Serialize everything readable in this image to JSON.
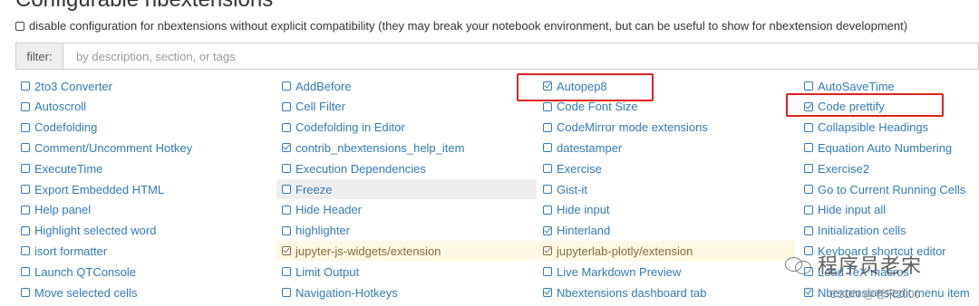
{
  "page": {
    "title": "Configurable nbextensions",
    "compat_checkbox_label": "disable configuration for nbextensions without explicit compatibility (they may break your notebook environment, but can be useful to show for nbextension development)",
    "compat_checked": false
  },
  "filter": {
    "label": "filter:",
    "placeholder": "by description, section, or tags"
  },
  "extensions": {
    "col1": [
      {
        "label": "2to3 Converter",
        "checked": false
      },
      {
        "label": "Autoscroll",
        "checked": false
      },
      {
        "label": "Codefolding",
        "checked": false
      },
      {
        "label": "Comment/Uncomment Hotkey",
        "checked": false
      },
      {
        "label": "ExecuteTime",
        "checked": false
      },
      {
        "label": "Export Embedded HTML",
        "checked": false
      },
      {
        "label": "Help panel",
        "checked": false
      },
      {
        "label": "Highlight selected word",
        "checked": false
      },
      {
        "label": "isort formatter",
        "checked": false
      },
      {
        "label": "Launch QTConsole",
        "checked": false
      },
      {
        "label": "Move selected cells",
        "checked": false
      }
    ],
    "col2": [
      {
        "label": "AddBefore",
        "checked": false
      },
      {
        "label": "Cell Filter",
        "checked": false
      },
      {
        "label": "Codefolding in Editor",
        "checked": false
      },
      {
        "label": "contrib_nbextensions_help_item",
        "checked": true
      },
      {
        "label": "Execution Dependencies",
        "checked": false
      },
      {
        "label": "Freeze",
        "checked": false,
        "selected": true
      },
      {
        "label": "Hide Header",
        "checked": false
      },
      {
        "label": "highlighter",
        "checked": false
      },
      {
        "label": "jupyter-js-widgets/extension",
        "checked": true,
        "broken": true
      },
      {
        "label": "Limit Output",
        "checked": false
      },
      {
        "label": "Navigation-Hotkeys",
        "checked": false
      }
    ],
    "col3": [
      {
        "label": "Autopep8",
        "checked": true
      },
      {
        "label": "Code Font Size",
        "checked": false
      },
      {
        "label": "CodeMirror mode extensions",
        "checked": false
      },
      {
        "label": "datestamper",
        "checked": false
      },
      {
        "label": "Exercise",
        "checked": false
      },
      {
        "label": "Gist-it",
        "checked": false
      },
      {
        "label": "Hide input",
        "checked": false
      },
      {
        "label": "Hinterland",
        "checked": true
      },
      {
        "label": "jupyterlab-plotly/extension",
        "checked": true,
        "broken": true
      },
      {
        "label": "Live Markdown Preview",
        "checked": false
      },
      {
        "label": "Nbextensions dashboard tab",
        "checked": true
      }
    ],
    "col4": [
      {
        "label": "AutoSaveTime",
        "checked": false
      },
      {
        "label": "Code prettify",
        "checked": true
      },
      {
        "label": "Collapsible Headings",
        "checked": false
      },
      {
        "label": "Equation Auto Numbering",
        "checked": false
      },
      {
        "label": "Exercise2",
        "checked": false
      },
      {
        "label": "Go to Current Running Cells",
        "checked": false
      },
      {
        "label": "Hide input all",
        "checked": false
      },
      {
        "label": "Initialization cells",
        "checked": false
      },
      {
        "label": "Keyboard shortcut editor",
        "checked": false
      },
      {
        "label": "Load TeX macros",
        "checked": false
      },
      {
        "label": "Nbextensions edit menu item",
        "checked": true
      }
    ]
  },
  "annotations": {
    "highlight_color": "#e02020",
    "highlighted_items": [
      "Autopep8",
      "Code prettify"
    ]
  },
  "watermark": {
    "text": "程序员老宋",
    "csdn": "CSDN @老宋2000"
  },
  "colors": {
    "link": "#337ab7",
    "selected_bg": "#eeeeee",
    "broken_bg": "#fcf8e3"
  }
}
